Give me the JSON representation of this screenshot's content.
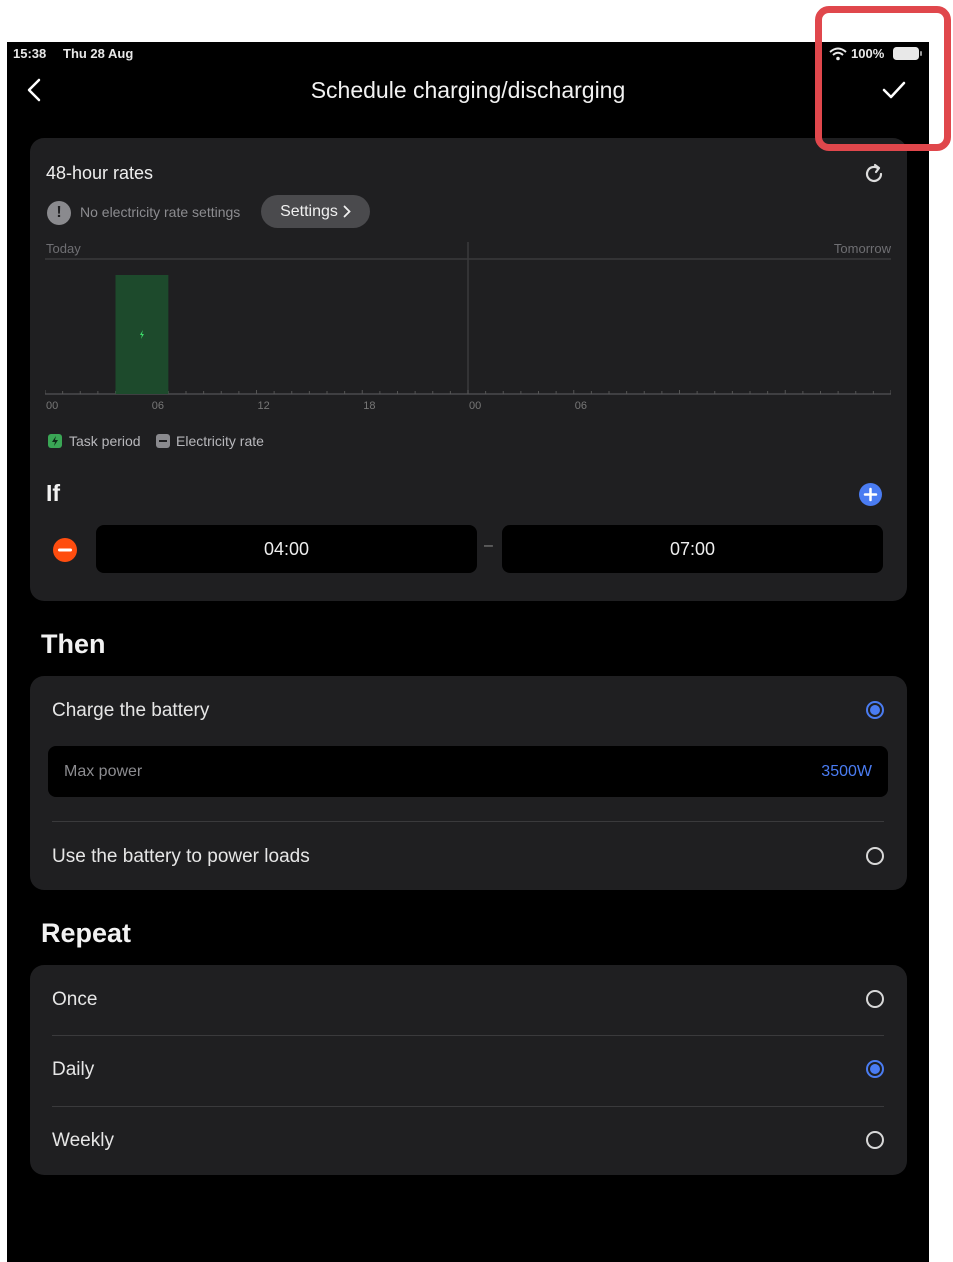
{
  "status_bar": {
    "time": "15:38",
    "date": "Thu 28 Aug",
    "battery": "100%"
  },
  "header": {
    "title": "Schedule charging/discharging"
  },
  "rates": {
    "title": "48-hour rates",
    "notice": "No electricity rate settings",
    "settings_label": "Settings",
    "today_label": "Today",
    "tomorrow_label": "Tomorrow",
    "ticks": [
      "00",
      "06",
      "12",
      "18",
      "00",
      "06"
    ],
    "legend_task": "Task period",
    "legend_rate": "Electricity rate"
  },
  "chart_data": {
    "type": "bar",
    "x_unit": "hour of 48-hour window",
    "xlim": [
      0,
      48
    ],
    "tick_labels": [
      "00",
      "06",
      "12",
      "18",
      "00",
      "06"
    ],
    "task_periods": [
      {
        "start": 4,
        "end": 7
      }
    ],
    "electricity_rates": []
  },
  "if_section": {
    "title": "If",
    "start_time": "04:00",
    "end_time": "07:00",
    "separator": "–"
  },
  "then_section": {
    "title": "Then",
    "charge_label": "Charge the battery",
    "charge_selected": true,
    "max_power_label": "Max power",
    "max_power_value": "3500W",
    "power_loads_label": "Use the battery to power loads",
    "power_loads_selected": false
  },
  "repeat_section": {
    "title": "Repeat",
    "options": [
      {
        "label": "Once",
        "selected": false
      },
      {
        "label": "Daily",
        "selected": true
      },
      {
        "label": "Weekly",
        "selected": false
      }
    ]
  },
  "colors": {
    "accent": "#4a7cf2",
    "remove": "#ff4d0f",
    "task_fill": "#1d4a2c",
    "highlight": "#e0474c"
  }
}
